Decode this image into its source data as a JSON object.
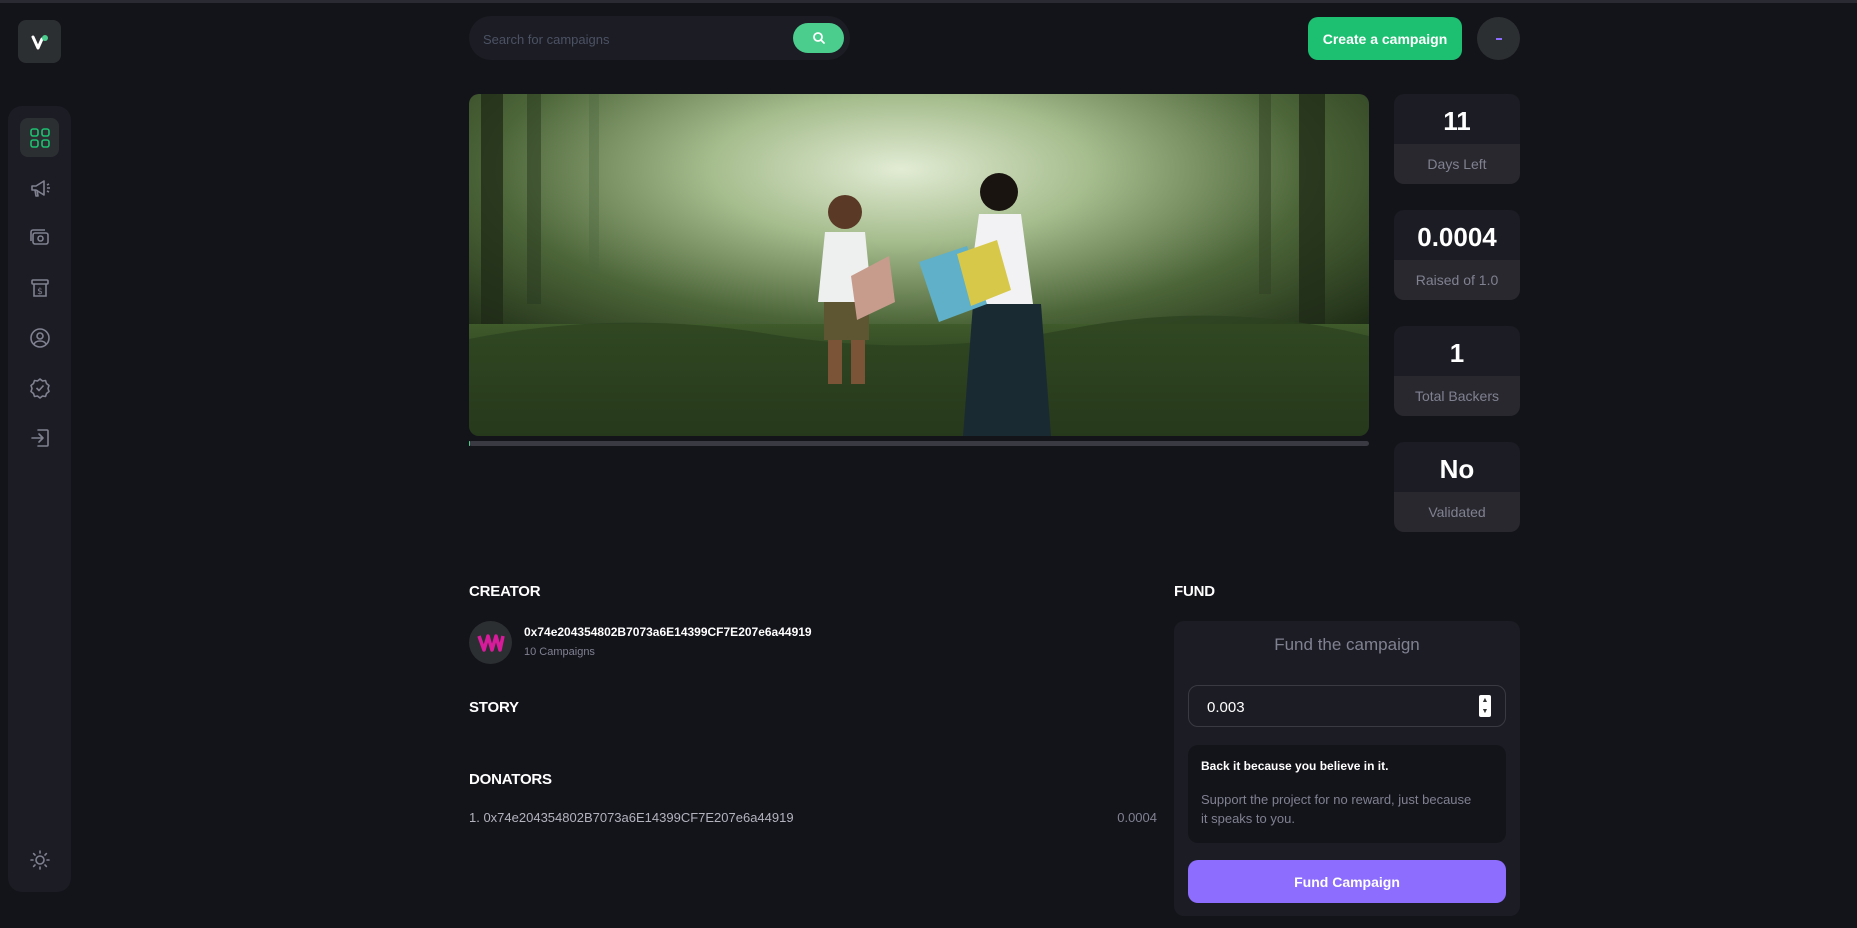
{
  "header": {
    "search_placeholder": "Search for campaigns",
    "create_button": "Create a campaign"
  },
  "sidebar": {
    "items": [
      {
        "icon": "dashboard-icon",
        "active": true
      },
      {
        "icon": "megaphone-icon",
        "active": false
      },
      {
        "icon": "payment-icon",
        "active": false
      },
      {
        "icon": "withdraw-icon",
        "active": false
      },
      {
        "icon": "profile-icon",
        "active": false
      },
      {
        "icon": "verified-icon",
        "active": false
      },
      {
        "icon": "logout-icon",
        "active": false
      }
    ],
    "theme_toggle_icon": "sun-icon"
  },
  "campaign": {
    "funding_fraction": 0.0004
  },
  "stats": [
    {
      "value": "11",
      "label": "Days Left"
    },
    {
      "value": "0.0004",
      "label": "Raised of 1.0"
    },
    {
      "value": "1",
      "label": "Total Backers"
    },
    {
      "value": "No",
      "label": "Validated"
    }
  ],
  "creator": {
    "title": "Creator",
    "address": "0x74e204354802B7073a6E14399CF7E207e6a44919",
    "campaigns": "10 Campaigns"
  },
  "story": {
    "title": "Story"
  },
  "donators": {
    "title": "Donators",
    "list": [
      {
        "label": "1. 0x74e204354802B7073a6E14399CF7E207e6a44919",
        "amount": "0.0004"
      }
    ]
  },
  "fund": {
    "title": "Fund",
    "heading": "Fund the campaign",
    "amount_value": "0.003",
    "info_title": "Back it because you believe in it.",
    "info_text": "Support the project for no reward, just because it speaks to you.",
    "button": "Fund Campaign"
  },
  "colors": {
    "accent_green": "#1dc071",
    "accent_purple": "#8c6dfd",
    "background": "#13131a",
    "card": "#1c1c24"
  }
}
